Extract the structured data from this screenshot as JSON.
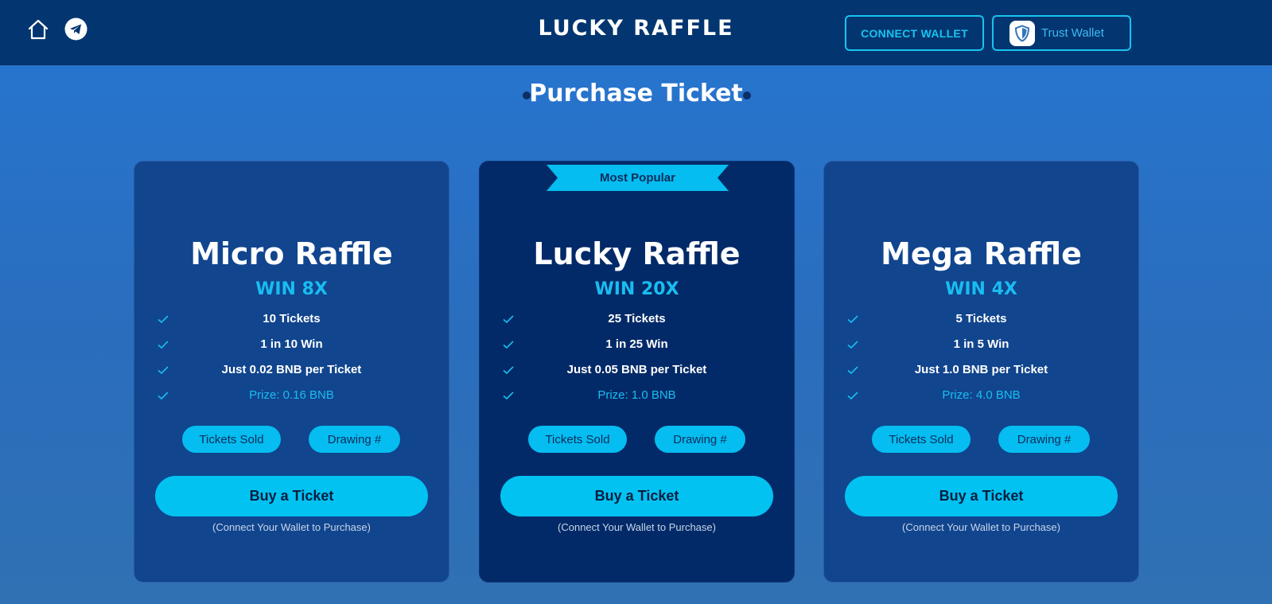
{
  "header": {
    "brand": "LUCKY RAFFLE",
    "connect_label": "CONNECT WALLET",
    "trust_label": "Trust Wallet",
    "home_icon": "home-icon",
    "telegram_icon": "telegram-icon",
    "trust_icon": "shield-icon"
  },
  "section": {
    "title": "Purchase Ticket"
  },
  "colors": {
    "accent": "#02c2f2",
    "header_bg": "#033670",
    "card_bg": "#11458e",
    "popular_bg": "#032a68"
  },
  "cards": [
    {
      "title": "Micro Raffle",
      "win": "WIN 8X",
      "features": [
        "10 Tickets",
        "1 in 10 Win",
        "Just 0.02 BNB per Ticket"
      ],
      "prize": "Prize: 0.16 BNB",
      "tickets_sold": "Tickets Sold",
      "drawing": "Drawing #",
      "buy": "Buy a Ticket",
      "hint": "(Connect Your Wallet to Purchase)"
    },
    {
      "badge": "Most Popular",
      "title": "Lucky Raffle",
      "win": "WIN 20X",
      "features": [
        "25 Tickets",
        "1 in 25 Win",
        "Just 0.05 BNB per Ticket"
      ],
      "prize": "Prize: 1.0 BNB",
      "tickets_sold": "Tickets Sold",
      "drawing": "Drawing #",
      "buy": "Buy a Ticket",
      "hint": "(Connect Your Wallet to Purchase)"
    },
    {
      "title": "Mega Raffle",
      "win": "WIN 4X",
      "features": [
        "5 Tickets",
        "1 in 5 Win",
        "Just 1.0 BNB per Ticket"
      ],
      "prize": "Prize: 4.0 BNB",
      "tickets_sold": "Tickets Sold",
      "drawing": "Drawing #",
      "buy": "Buy a Ticket",
      "hint": "(Connect Your Wallet to Purchase)"
    }
  ]
}
